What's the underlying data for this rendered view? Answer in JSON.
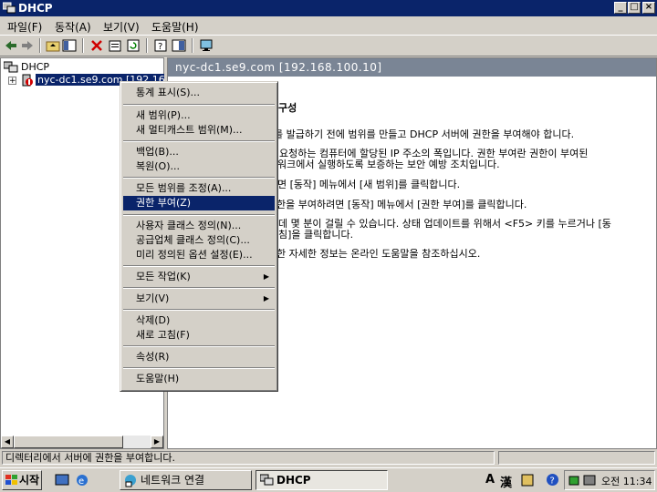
{
  "window": {
    "title": "DHCP"
  },
  "menubar": [
    {
      "label": "파일(F)"
    },
    {
      "label": "동작(A)"
    },
    {
      "label": "보기(V)"
    },
    {
      "label": "도움말(H)"
    }
  ],
  "tree": {
    "root": "DHCP",
    "server": "nyc-dc1.se9.com [192.168"
  },
  "right": {
    "header": "nyc-dc1.se9.com [192.168.100.10]",
    "lines": [
      "구성",
      "를 발급하기 전에 범위를 만들고 DHCP 서버에 권한을 부여해야 합니다.",
      "요청하는 컴퓨터에 할당된 IP 주소의 폭입니다. 권한 부여란 권한이 부여된",
      "워크에서 실행하도록 보증하는 보안 예방 조치입니다.",
      "면 [동작] 메뉴에서 [새 범위]를 클릭합니다.",
      "한을 부여하려면 [동작] 메뉴에서 [권한 부여]를 클릭합니다.",
      "데 몇 분이 걸릴 수 있습니다. 상태 업데이트를 위해서 <F5> 키를 누르거나 [동",
      "침]을 클릭합니다.",
      "한 자세한 정보는 온라인 도움말을 참조하십시오."
    ]
  },
  "context_menu": {
    "items": [
      {
        "label": "통계 표시(S)..."
      },
      {
        "label": "새 범위(P)..."
      },
      {
        "label": "새 멀티캐스트 범위(M)..."
      },
      {
        "label": "백업(B)..."
      },
      {
        "label": "복원(O)..."
      },
      {
        "label": "모든 범위를 조정(A)..."
      },
      {
        "label": "권한 부여(Z)",
        "selected": true
      },
      {
        "label": "사용자 클래스 정의(N)..."
      },
      {
        "label": "공급업체 클래스 정의(C)..."
      },
      {
        "label": "미리 정의된 옵션 설정(E)..."
      },
      {
        "label": "모든 작업(K)",
        "submenu": true
      },
      {
        "label": "보기(V)",
        "submenu": true
      },
      {
        "label": "삭제(D)"
      },
      {
        "label": "새로 고침(F)"
      },
      {
        "label": "속성(R)"
      },
      {
        "label": "도움말(H)"
      }
    ]
  },
  "status": {
    "text": "디렉터리에서 서버에 권한을 부여합니다."
  },
  "taskbar": {
    "start": "시작",
    "tasks": [
      {
        "label": "네트워크 연결"
      },
      {
        "label": "DHCP"
      }
    ],
    "tray": {
      "ime1": "A",
      "ime2": "漢",
      "clock": "오전 11:34"
    }
  },
  "colors": {
    "title_bg": "#0a246a",
    "selection": "#0a246a",
    "header_bg": "#7a8595",
    "chrome": "#d4d0c8"
  }
}
